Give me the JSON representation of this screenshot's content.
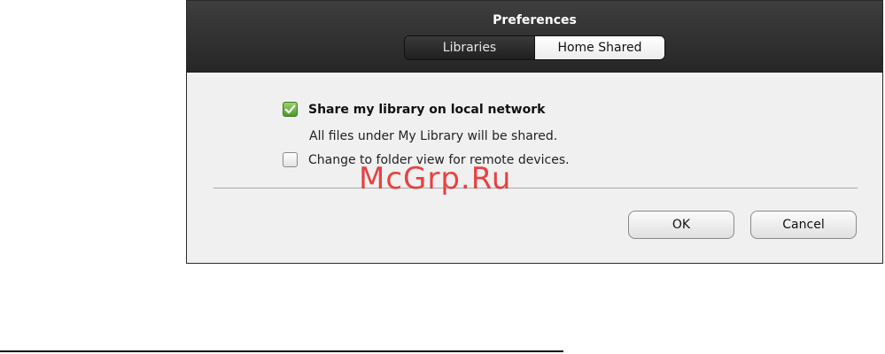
{
  "dialog": {
    "title": "Preferences",
    "tabs": [
      {
        "label": "Libraries",
        "selected": false
      },
      {
        "label": "Home Shared",
        "selected": true
      }
    ]
  },
  "options": {
    "share_library": {
      "label": "Share my library on local network",
      "checked": true
    },
    "share_description": "All files under My Library will be shared.",
    "folder_view": {
      "label": "Change to folder view for remote devices.",
      "checked": false
    }
  },
  "buttons": {
    "ok_label": "OK",
    "cancel_label": "Cancel"
  },
  "watermark": "McGrp.Ru",
  "colors": {
    "titlebar": "#2f2f2f",
    "body": "#f0f0f0",
    "check_green": "#4c9a2a",
    "watermark": "#e52424"
  }
}
